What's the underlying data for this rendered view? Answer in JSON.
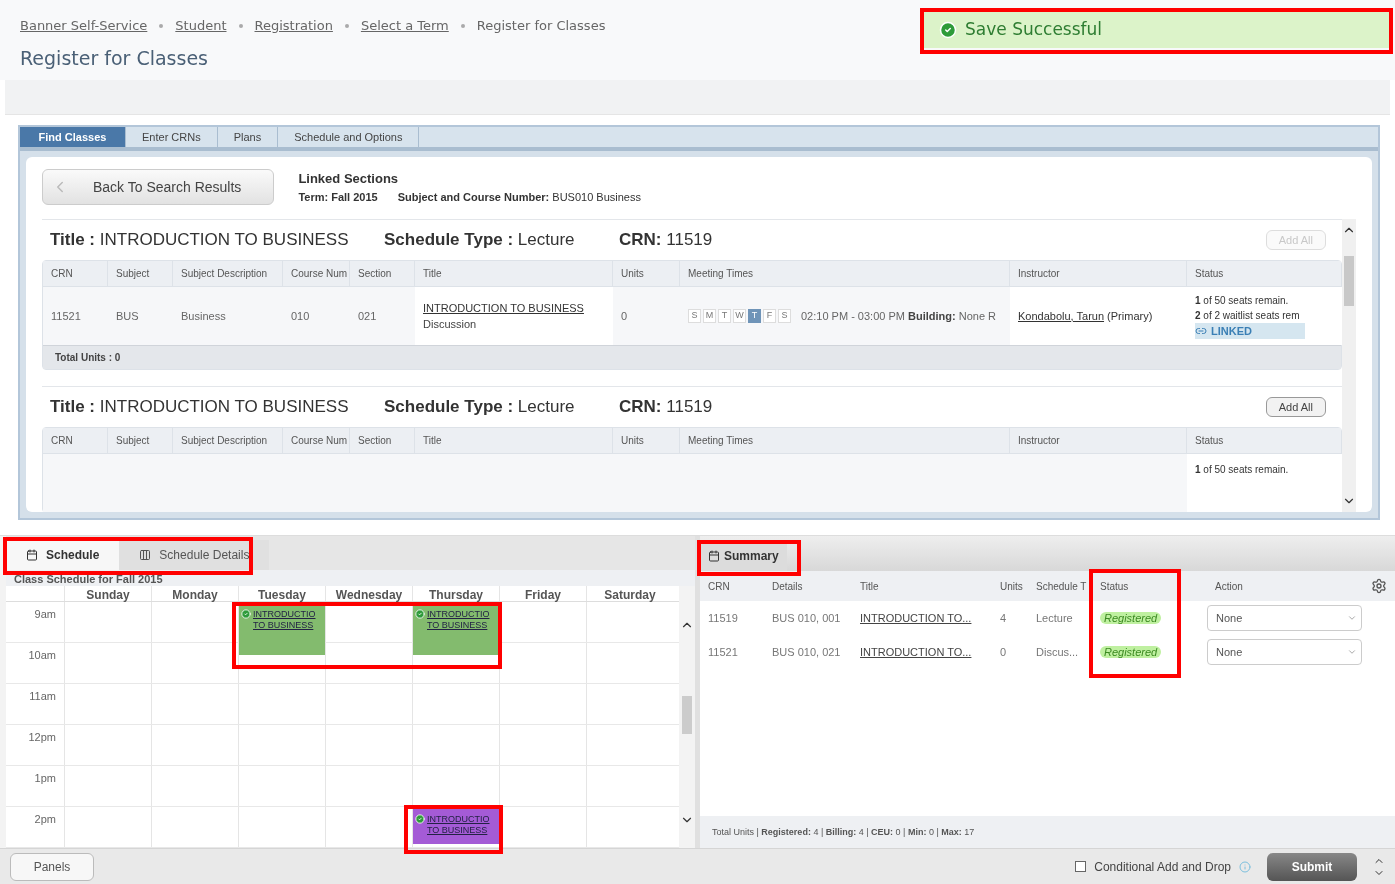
{
  "breadcrumbs": [
    {
      "label": "Banner Self-Service",
      "link": true
    },
    {
      "label": "Student",
      "link": true
    },
    {
      "label": "Registration",
      "link": true
    },
    {
      "label": "Select a Term",
      "link": true
    },
    {
      "label": "Register for Classes",
      "link": false
    }
  ],
  "page_title": "Register for Classes",
  "notification": {
    "text": "Save Successful",
    "kind": "success"
  },
  "tabs": [
    {
      "label": "Find Classes",
      "selected": true
    },
    {
      "label": "Enter CRNs",
      "selected": false
    },
    {
      "label": "Plans",
      "selected": false
    },
    {
      "label": "Schedule and Options",
      "selected": false
    }
  ],
  "back_button": "Back To Search Results",
  "linked": {
    "heading": "Linked Sections",
    "term": "Term: Fall 2015",
    "subject_label": "Subject and Course Number:",
    "subject_value": "BUS010 Business"
  },
  "sections": [
    {
      "title_label": "Title :",
      "title": "INTRODUCTION TO BUSINESS",
      "type_label": "Schedule Type :",
      "type": "Lecture",
      "crn_label": "CRN:",
      "crn": "11519",
      "add_all": {
        "label": "Add All",
        "disabled": true
      },
      "total_units": "Total Units : 0",
      "columns": [
        "CRN",
        "Subject",
        "Subject Description",
        "Course Num",
        "Section",
        "Title",
        "Units",
        "Meeting Times",
        "Instructor",
        "Status"
      ],
      "rows": [
        {
          "crn": "11521",
          "subject": "BUS",
          "description": "Business",
          "course_num": "010",
          "section": "021",
          "title": "INTRODUCTION TO BUSINESS",
          "title_sub": "Discussion",
          "units": "0",
          "days": [
            {
              "label": "S",
              "on": false
            },
            {
              "label": "M",
              "on": false
            },
            {
              "label": "T",
              "on": false
            },
            {
              "label": "W",
              "on": false
            },
            {
              "label": "T",
              "on": true
            },
            {
              "label": "F",
              "on": false
            },
            {
              "label": "S",
              "on": false
            }
          ],
          "time": "02:10 PM - 03:00 PM",
          "building_label": "Building:",
          "building": "None",
          "room": "R",
          "instructor": "Kondabolu, Tarun",
          "instructor_role": "(Primary)",
          "status_lines": [
            "**1** of 50 seats remain.",
            "**2** of 2 waitlist seats rem"
          ],
          "linked": "LINKED"
        }
      ]
    },
    {
      "title_label": "Title :",
      "title": "INTRODUCTION TO BUSINESS",
      "type_label": "Schedule Type :",
      "type": "Lecture",
      "crn_label": "CRN:",
      "crn": "11519",
      "add_all": {
        "label": "Add All",
        "disabled": false
      },
      "columns": [
        "CRN",
        "Subject",
        "Subject Description",
        "Course Num",
        "Section",
        "Title",
        "Units",
        "Meeting Times",
        "Instructor",
        "Status"
      ],
      "rows": [
        {
          "status_lines": [
            "**1** of 50 seats remain."
          ]
        }
      ]
    }
  ],
  "schedule": {
    "tabs": [
      {
        "label": "Schedule",
        "selected": true
      },
      {
        "label": "Schedule Details",
        "selected": false
      }
    ],
    "caption": "Class Schedule for Fall 2015",
    "days": [
      "Sunday",
      "Monday",
      "Tuesday",
      "Wednesday",
      "Thursday",
      "Friday",
      "Saturday"
    ],
    "times": [
      "9am",
      "10am",
      "11am",
      "12pm",
      "1pm",
      "2pm"
    ],
    "events": [
      {
        "lines": [
          "INTRODUCTIO",
          "TO BUSINESS"
        ],
        "color": "#83bb6e"
      },
      {
        "lines": [
          "INTRODUCTIO",
          "TO BUSINESS"
        ],
        "color": "#83bb6e"
      },
      {
        "lines": [
          "INTRODUCTIO",
          "TO BUSINESS"
        ],
        "color": "#a45bd6"
      }
    ]
  },
  "summary": {
    "tab": "Summary",
    "columns": [
      "CRN",
      "Details",
      "Title",
      "Units",
      "Schedule T",
      "Status",
      "Action"
    ],
    "rows": [
      {
        "crn": "11519",
        "details": "BUS 010, 001",
        "title": "INTRODUCTION TO...",
        "units": "4",
        "schedule_type": "Lecture",
        "status": "Registered",
        "action": "None"
      },
      {
        "crn": "11521",
        "details": "BUS 010, 021",
        "title": "INTRODUCTION TO...",
        "units": "0",
        "schedule_type": "Discus...",
        "status": "Registered",
        "action": "None"
      }
    ],
    "footer": "Total Units | **Registered:** 4 | **Billing:** 4 | **CEU:** 0 | **Min:** 0 | **Max:** 17"
  },
  "bottom": {
    "panels_button": "Panels",
    "conditional": {
      "label": "Conditional Add and Drop",
      "checked": false
    },
    "submit": "Submit"
  }
}
